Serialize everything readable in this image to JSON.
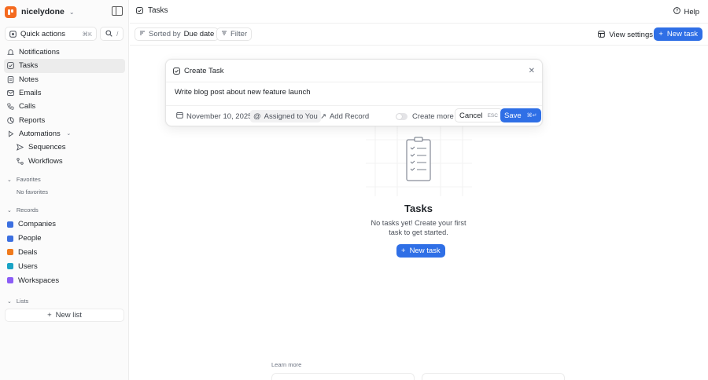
{
  "workspace": {
    "name": "nicelydone"
  },
  "sidebar": {
    "quick_actions": {
      "label": "Quick actions",
      "shortcut": "⌘K"
    },
    "search_shortcut": "/",
    "items": [
      {
        "label": "Notifications",
        "icon": "bell-icon"
      },
      {
        "label": "Tasks",
        "icon": "check-square-icon",
        "active": true
      },
      {
        "label": "Notes",
        "icon": "note-icon"
      },
      {
        "label": "Emails",
        "icon": "mail-icon"
      },
      {
        "label": "Calls",
        "icon": "phone-icon"
      },
      {
        "label": "Reports",
        "icon": "chart-icon"
      },
      {
        "label": "Automations",
        "icon": "play-icon"
      },
      {
        "label": "Sequences",
        "icon": "send-icon"
      },
      {
        "label": "Workflows",
        "icon": "workflow-icon"
      }
    ],
    "favorites": {
      "header": "Favorites",
      "empty": "No favorites"
    },
    "records": {
      "header": "Records",
      "items": [
        {
          "label": "Companies",
          "color": "#3b6fe0"
        },
        {
          "label": "People",
          "color": "#3b6fe0"
        },
        {
          "label": "Deals",
          "color": "#f07a1c"
        },
        {
          "label": "Users",
          "color": "#19a3c5"
        },
        {
          "label": "Workspaces",
          "color": "#8b5cf6"
        }
      ]
    },
    "lists": {
      "header": "Lists",
      "new_list": "New list"
    }
  },
  "header": {
    "title": "Tasks",
    "help": "Help"
  },
  "toolbar": {
    "sorted_by_prefix": "Sorted by",
    "sorted_by_value": "Due date",
    "filter": "Filter",
    "view_settings": "View settings",
    "new_task": "New task"
  },
  "empty_state": {
    "title": "Tasks",
    "description": "No tasks yet! Create your first task to get started.",
    "button": "New task"
  },
  "learn_more": "Learn more",
  "modal": {
    "title": "Create Task",
    "input_value": "Write blog post about new feature launch",
    "due_date": "November 10, 2025",
    "assigned": "Assigned to You",
    "add_record": "Add Record",
    "create_more": "Create more",
    "cancel": "Cancel",
    "cancel_key": "ESC",
    "save": "Save",
    "save_key": "⌘↵"
  },
  "colors": {
    "accent": "#2f6fe6",
    "brand": "#f46a1f"
  }
}
